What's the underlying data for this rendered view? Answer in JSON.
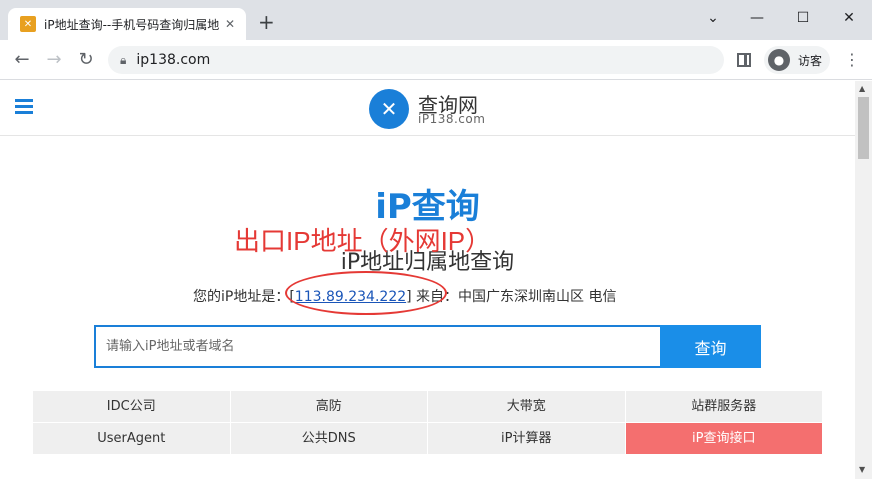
{
  "browser": {
    "tab_title": "iP地址查询--手机号码查询归属地",
    "url": "ip138.com",
    "profile_label": "访客",
    "icons": {
      "close": "close-icon",
      "new_tab": "plus-icon",
      "back": "back-arrow-icon",
      "forward": "forward-arrow-icon",
      "reload": "reload-icon",
      "lock": "lock-icon",
      "menu": "kebab-menu-icon"
    }
  },
  "site": {
    "logo_name": "查询网",
    "logo_domain": "iP138.com",
    "hero_title": "iP查询",
    "annotation": "出口IP地址（外网IP）",
    "subtitle": "iP地址归属地查询",
    "ip_prefix": "您的iP地址是：[",
    "ip_address": "113.89.234.222",
    "ip_suffix": "] 来自：中国广东深圳南山区 电信",
    "search_placeholder": "请输入iP地址或者域名",
    "search_button": "查询",
    "grid": [
      [
        "IDC公司",
        "高防",
        "大带宽",
        "站群服务器"
      ],
      [
        "UserAgent",
        "公共DNS",
        "iP计算器",
        "iP查询接口"
      ]
    ],
    "colors": {
      "brand": "#1a7fd8",
      "annotation": "#e53935",
      "hot_cell": "#f46f6f"
    }
  }
}
